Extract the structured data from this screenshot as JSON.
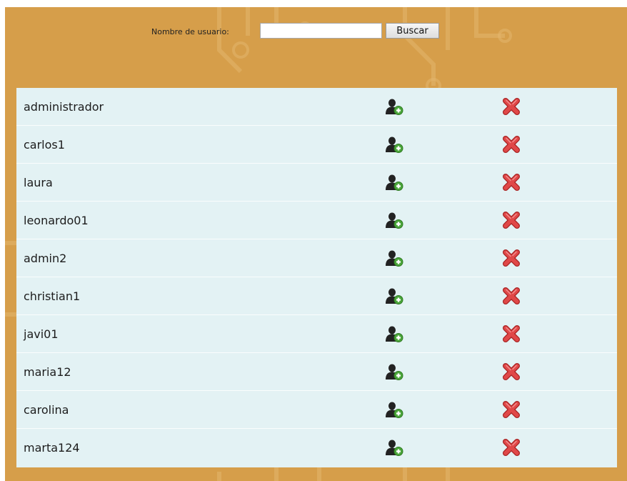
{
  "search": {
    "label": "Nombre de usuario:",
    "value": "",
    "placeholder": "",
    "button_label": "Buscar"
  },
  "colors": {
    "frame_background": "#d69e4a",
    "table_background": "#e3f2f4",
    "delete_icon": "#d63b3b",
    "add_icon": "#3f9a2e"
  },
  "icons": {
    "add": "add-user-icon",
    "delete": "delete-x-icon"
  },
  "users": [
    {
      "username": "administrador"
    },
    {
      "username": "carlos1"
    },
    {
      "username": "laura"
    },
    {
      "username": "leonardo01"
    },
    {
      "username": "admin2"
    },
    {
      "username": "christian1"
    },
    {
      "username": "javi01"
    },
    {
      "username": "maria12"
    },
    {
      "username": "carolina"
    },
    {
      "username": "marta124"
    }
  ]
}
